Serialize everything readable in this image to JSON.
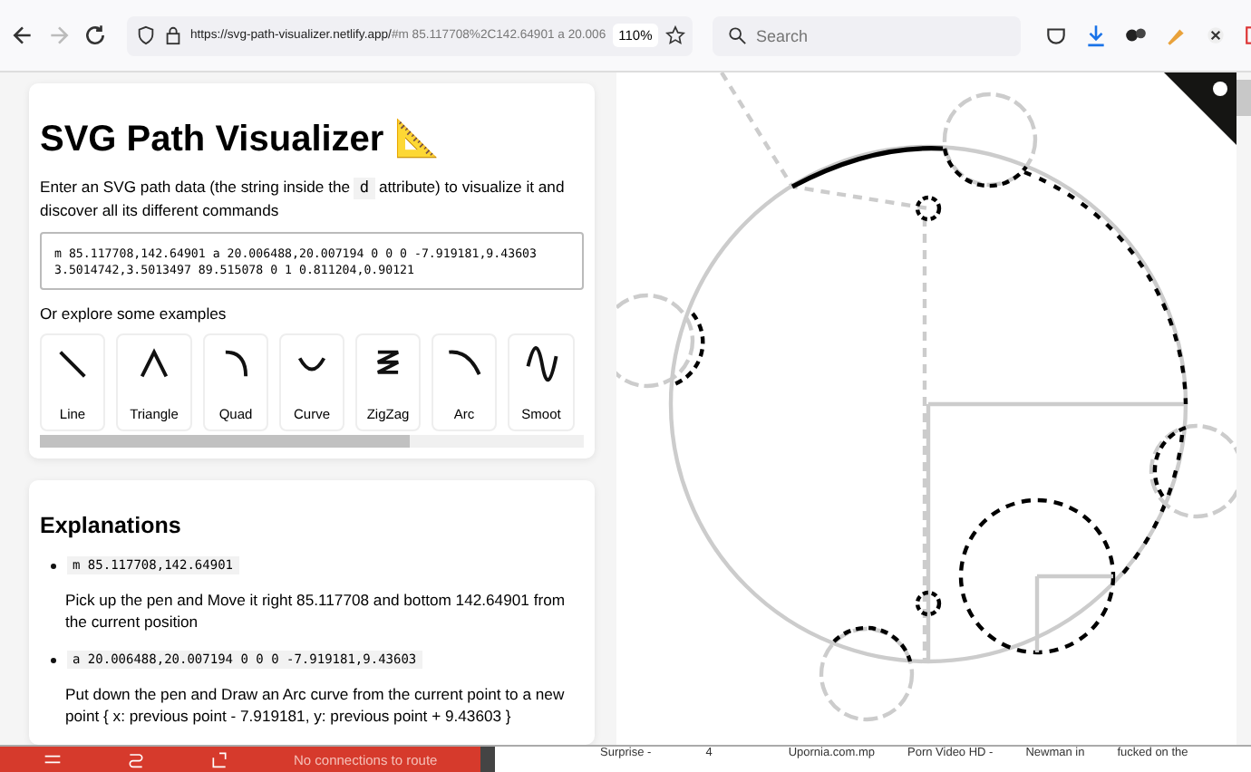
{
  "browser": {
    "url_host": "https://svg-path-visualizer.netlify.app/",
    "url_rest": "#m 85.117708%2C142.64901 a 20.006",
    "zoom": "110%",
    "search_placeholder": "Search"
  },
  "intro_card": {
    "title": "SVG Path Visualizer",
    "emoji": "📐",
    "intro_before": "Enter an SVG path data (the string inside the",
    "intro_code": "d",
    "intro_after": "attribute) to visualize it and discover all its different commands",
    "path_input": "m 85.117708,142.64901 a 20.006488,20.007194 0 0 0 -7.919181,9.43603\n3.5014742,3.5013497 89.515078 0 1 0.811204,0.90121",
    "examples_label": "Or explore some examples",
    "examples": [
      "Line",
      "Triangle",
      "Quad",
      "Curve",
      "ZigZag",
      "Arc",
      "Smoot"
    ]
  },
  "explanations": {
    "title": "Explanations",
    "items": [
      {
        "command": "m 85.117708,142.64901",
        "description": "Pick up the pen and Move it right 85.117708 and bottom 142.64901 from the current position"
      },
      {
        "command": "a 20.006488,20.007194 0 0 0 -7.919181,9.43603",
        "description": "Put down the pen and Draw an Arc curve from the current point to a new point { x: previous point - 7.919181, y: previous point + 9.43603 }"
      }
    ]
  },
  "taskbar": {
    "status": "No connections to route",
    "files": [
      "Surprise -",
      "4",
      "Upornia.com.mp",
      "Porn Video HD -",
      "Newman in",
      "fucked on the"
    ]
  }
}
